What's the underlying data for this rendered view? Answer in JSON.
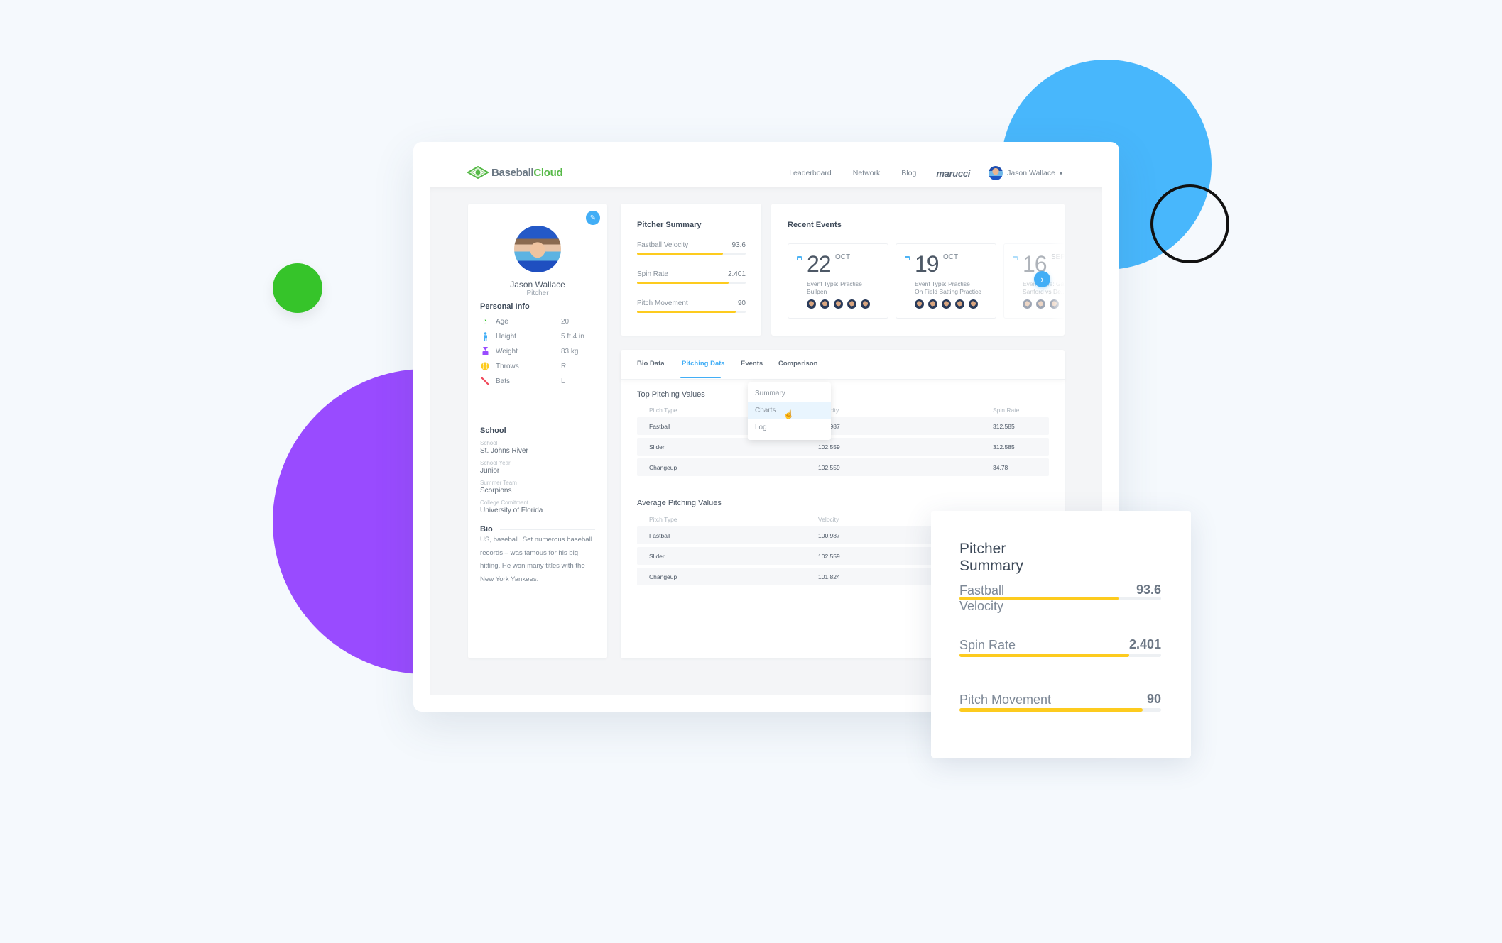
{
  "colors": {
    "accent_blue": "#42aef6",
    "bar_yellow": "#fdcb1e",
    "deco_blue": "#48b7fc",
    "deco_green": "#36c42a",
    "deco_purple": "#994bff",
    "logo_green": "#56b947"
  },
  "header": {
    "logo": {
      "part1": "Baseball",
      "part2": "Cloud"
    },
    "nav": [
      "Leaderboard",
      "Network",
      "Blog"
    ],
    "sponsor": "marucci",
    "user_name": "Jason Wallace",
    "user_caret": "▾"
  },
  "profile": {
    "edit_icon": "✎",
    "name": "Jason Wallace",
    "role": "Pitcher",
    "personal_info_title": "Personal Info",
    "personal_info": [
      {
        "icon": "age-icon",
        "glyph": "◔",
        "label": "Age",
        "value": "20"
      },
      {
        "icon": "height-icon",
        "glyph": "🕴",
        "label": "Height",
        "value": "5 ft 4 in"
      },
      {
        "icon": "weight-icon",
        "glyph": "⧗",
        "label": "Weight",
        "value": "83 kg"
      },
      {
        "icon": "baseball-icon",
        "glyph": "●",
        "label": "Throws",
        "value": "R"
      },
      {
        "icon": "bat-icon",
        "glyph": "╲",
        "label": "Bats",
        "value": "L"
      }
    ],
    "school_title": "School",
    "school": [
      {
        "label": "School",
        "value": "St. Johns River"
      },
      {
        "label": "School Year",
        "value": "Junior"
      },
      {
        "label": "Summer Team",
        "value": "Scorpions"
      },
      {
        "label": "College Comitment",
        "value": "University of Florida"
      }
    ],
    "bio_title": "Bio",
    "bio": "US, baseball. Set numerous baseball records – was famous for his big hitting. He won many titles with the New York Yankees."
  },
  "pitcher_summary": {
    "title": "Pitcher Summary",
    "metrics": [
      {
        "label": "Fastball Velocity",
        "value": "93.6",
        "fill": 0.79
      },
      {
        "label": "Spin Rate",
        "value": "2.401",
        "fill": 0.84
      },
      {
        "label": "Pitch Movement",
        "value": "90",
        "fill": 0.91
      }
    ]
  },
  "recent_events": {
    "title": "Recent Events",
    "next_icon": "›",
    "events": [
      {
        "day": "22",
        "month": "OCT",
        "type": "Event Type: Practise",
        "name": "Bullpen",
        "attendees": 5
      },
      {
        "day": "19",
        "month": "OCT",
        "type": "Event Type: Practise",
        "name": "On Field Batting Practice",
        "attendees": 5
      },
      {
        "day": "16",
        "month": "SEP",
        "type": "Event Type: Game",
        "name": "Sanford vs De...",
        "attendees": 3
      }
    ]
  },
  "tabs": {
    "items": [
      "Bio Data",
      "Pitching Data",
      "Events",
      "Comparison"
    ],
    "active": "Pitching Data",
    "dropdown": [
      "Summary",
      "Charts",
      "Log"
    ],
    "dropdown_hover": "Charts"
  },
  "top_pitching": {
    "title": "Top Pitching Values",
    "columns": [
      "Pitch Type",
      "Velocity",
      "Spin Rate"
    ],
    "rows": [
      [
        "Fastball",
        "100.987",
        "312.585"
      ],
      [
        "Slider",
        "102.559",
        "312.585"
      ],
      [
        "Changeup",
        "102.559",
        "34.78"
      ]
    ]
  },
  "average_pitching": {
    "title": "Average Pitching Values",
    "columns": [
      "Pitch Type",
      "Velocity"
    ],
    "rows": [
      [
        "Fastball",
        "100.987"
      ],
      [
        "Slider",
        "102.559"
      ],
      [
        "Changeup",
        "101.824"
      ]
    ]
  },
  "floating_summary": {
    "title": "Pitcher Summary",
    "metrics": [
      {
        "label": "Fastball Velocity",
        "value": "93.6",
        "fill": 0.79
      },
      {
        "label": "Spin Rate",
        "value": "2.401",
        "fill": 0.84
      },
      {
        "label": "Pitch Movement",
        "value": "90",
        "fill": 0.91
      }
    ]
  }
}
